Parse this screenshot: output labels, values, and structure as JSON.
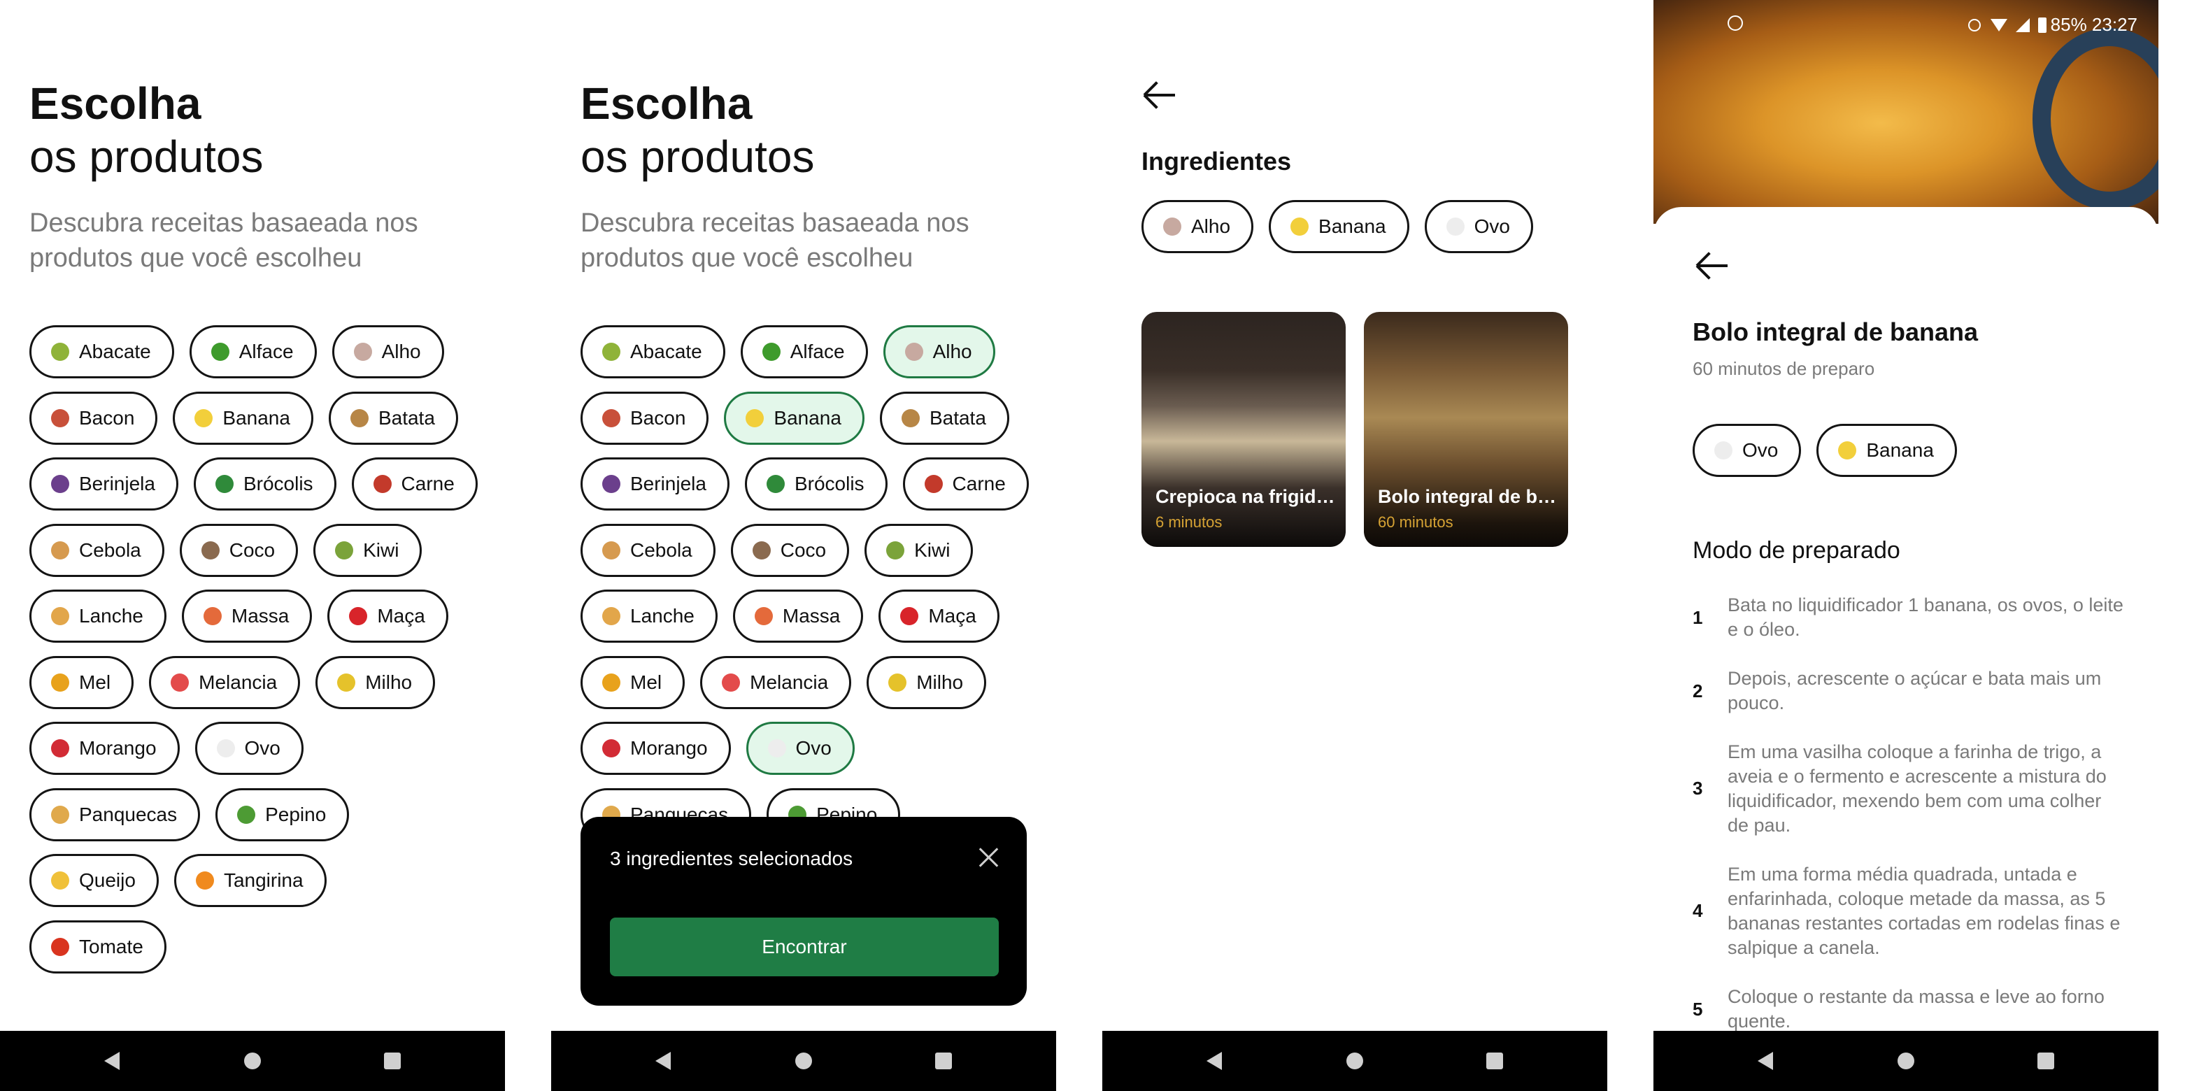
{
  "screen1": {
    "title_line1": "Escolha",
    "title_line2": "os produtos",
    "subtitle": "Descubra receitas basaeada nos produtos que você escolheu",
    "rows": [
      [
        {
          "label": "Abacate",
          "icon": "avocado-icon",
          "color": "#8fb339"
        },
        {
          "label": "Alface",
          "icon": "lettuce-icon",
          "color": "#3e9b2c"
        },
        {
          "label": "Alho",
          "icon": "garlic-icon",
          "color": "#c7a9a0"
        }
      ],
      [
        {
          "label": "Bacon",
          "icon": "bacon-icon",
          "color": "#c8503a"
        },
        {
          "label": "Banana",
          "icon": "banana-icon",
          "color": "#f2cf3b"
        },
        {
          "label": "Batata",
          "icon": "potato-icon",
          "color": "#b78646"
        }
      ],
      [
        {
          "label": "Berinjela",
          "icon": "eggplant-icon",
          "color": "#6b3f8c"
        },
        {
          "label": "Brócolis",
          "icon": "broccoli-icon",
          "color": "#2f8a3a"
        },
        {
          "label": "Carne",
          "icon": "meat-icon",
          "color": "#c33a2b"
        }
      ],
      [
        {
          "label": "Cebola",
          "icon": "onion-icon",
          "color": "#d69a4f"
        },
        {
          "label": "Coco",
          "icon": "coconut-icon",
          "color": "#8a6a4f"
        },
        {
          "label": "Kiwi",
          "icon": "kiwi-icon",
          "color": "#7ba33a"
        }
      ],
      [
        {
          "label": "Lanche",
          "icon": "sandwich-icon",
          "color": "#e2a64a"
        },
        {
          "label": "Massa",
          "icon": "pasta-icon",
          "color": "#e46a3b"
        },
        {
          "label": "Maça",
          "icon": "apple-icon",
          "color": "#d8242a"
        }
      ],
      [
        {
          "label": "Mel",
          "icon": "honey-icon",
          "color": "#e8a21c"
        },
        {
          "label": "Melancia",
          "icon": "watermelon-icon",
          "color": "#e34b4b"
        },
        {
          "label": "Milho",
          "icon": "corn-icon",
          "color": "#e5c22b"
        }
      ],
      [
        {
          "label": "Morango",
          "icon": "strawberry-icon",
          "color": "#d22b35"
        },
        {
          "label": "Ovo",
          "icon": "egg-icon",
          "color": "#ededed"
        }
      ],
      [
        {
          "label": "Panquecas",
          "icon": "pancakes-icon",
          "color": "#e0a94c"
        },
        {
          "label": "Pepino",
          "icon": "cucumber-icon",
          "color": "#4d9b34"
        }
      ],
      [
        {
          "label": "Queijo",
          "icon": "cheese-icon",
          "color": "#f0c13a"
        },
        {
          "label": "Tangirina",
          "icon": "tangerine-icon",
          "color": "#f08a1e"
        }
      ],
      [
        {
          "label": "Tomate",
          "icon": "tomato-icon",
          "color": "#d9341f"
        }
      ]
    ]
  },
  "screen2": {
    "title_line1": "Escolha",
    "title_line2": "os produtos",
    "subtitle": "Descubra receitas basaeada nos produtos que você escolheu",
    "selected": [
      "Alho",
      "Banana",
      "Ovo"
    ],
    "sheet": {
      "message": "3 ingredientes selecionados",
      "button_label": "Encontrar"
    }
  },
  "screen3": {
    "section_title": "Ingredientes",
    "chips": [
      {
        "label": "Alho",
        "icon": "garlic-icon",
        "color": "#c7a9a0"
      },
      {
        "label": "Banana",
        "icon": "banana-icon",
        "color": "#f2cf3b"
      },
      {
        "label": "Ovo",
        "icon": "egg-icon",
        "color": "#ededed"
      }
    ],
    "recipes": [
      {
        "name": "Crepioca na frigid…",
        "time": "6 minutos"
      },
      {
        "name": "Bolo integral de b…",
        "time": "60 minutos"
      }
    ]
  },
  "screen4": {
    "status_text": "85% 23:27",
    "recipe_title": "Bolo integral de banana",
    "prep_time": "60 minutos de preparo",
    "chips": [
      {
        "label": "Ovo",
        "icon": "egg-icon",
        "color": "#ededed"
      },
      {
        "label": "Banana",
        "icon": "banana-icon",
        "color": "#f2cf3b"
      }
    ],
    "mode_title": "Modo de preparado",
    "steps": [
      {
        "num": "1",
        "text": "Bata no liquidificador 1 banana, os ovos, o leite e o óleo."
      },
      {
        "num": "2",
        "text": "Depois, acrescente o açúcar e bata mais um pouco."
      },
      {
        "num": "3",
        "text": "Em uma vasilha coloque a farinha de trigo, a aveia e o fermento e acrescente a mistura do liquidificador, mexendo bem com uma colher de pau."
      },
      {
        "num": "4",
        "text": "Em uma forma média quadrada, untada e enfarinhada, coloque metade da massa, as 5 bananas restantes cortadas em rodelas finas e salpique a canela."
      },
      {
        "num": "5",
        "text": "Coloque o restante da massa e leve ao forno quente."
      }
    ]
  },
  "colors": {
    "selected_chip_bg": "#e3f7ea",
    "selected_chip_border": "#1f7a43",
    "primary_button": "#1f7d45",
    "time_accent": "#d6a334"
  }
}
